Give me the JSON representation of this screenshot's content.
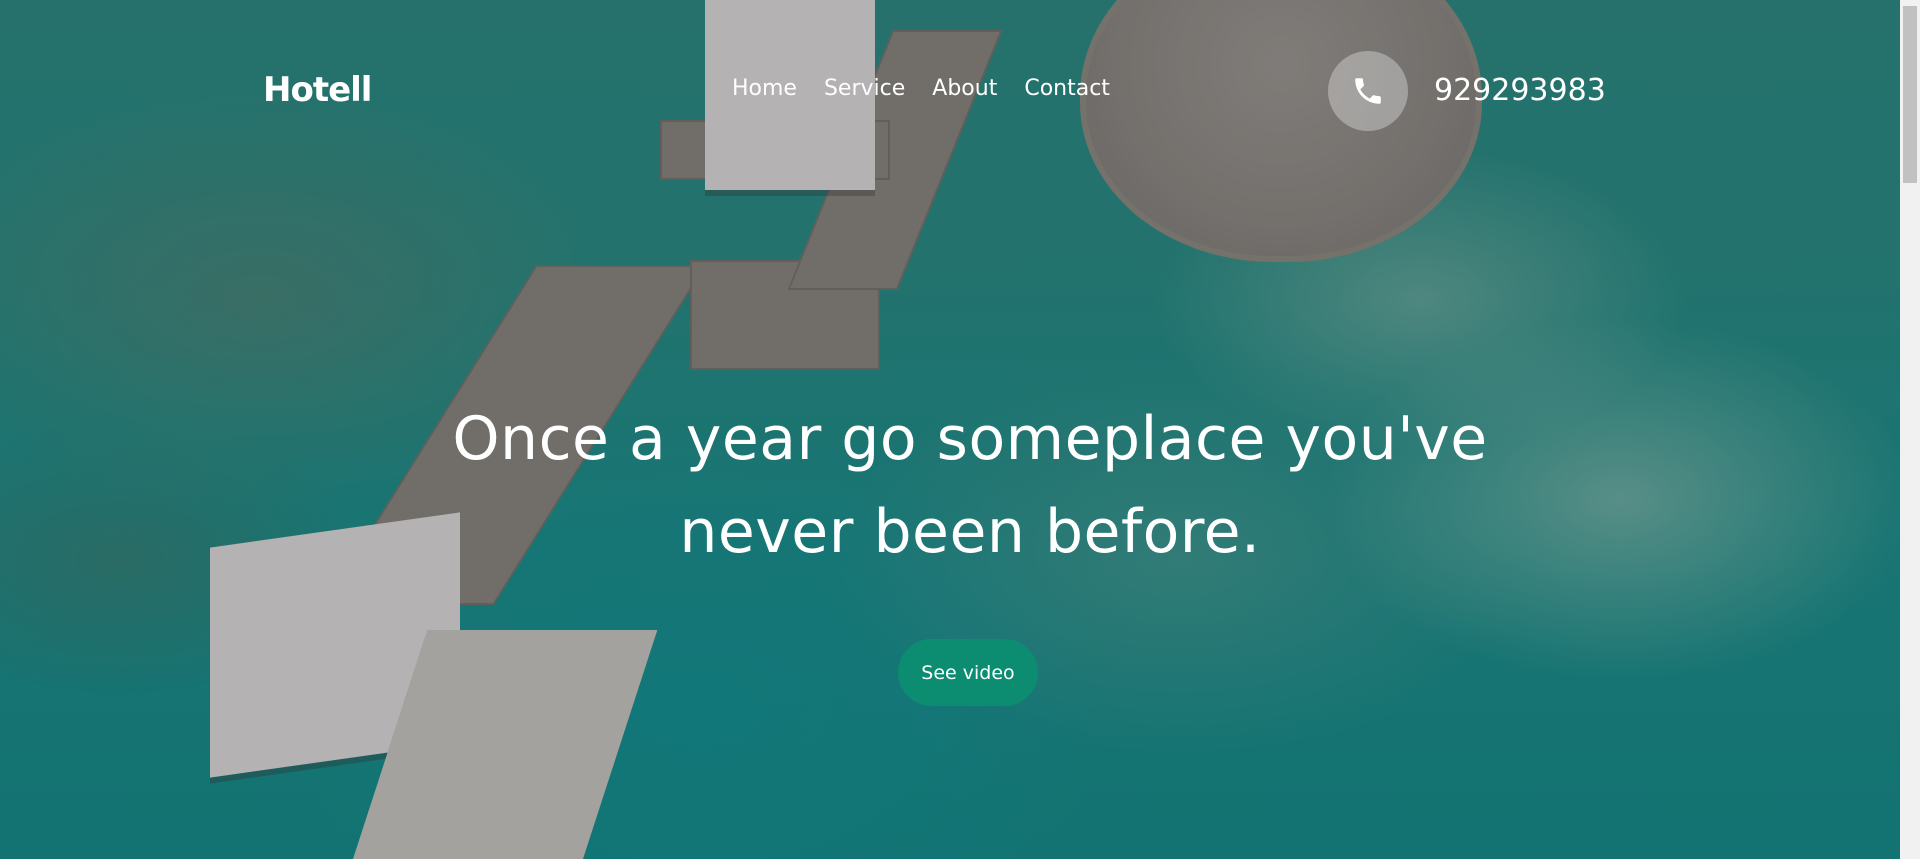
{
  "brand": {
    "logo_text": "Hotell"
  },
  "nav": {
    "items": [
      {
        "label": "Home"
      },
      {
        "label": "Service"
      },
      {
        "label": "About"
      },
      {
        "label": "Contact"
      }
    ]
  },
  "contact": {
    "phone_icon": "phone-icon",
    "phone_number": "929293983"
  },
  "hero": {
    "headline_line1": "Once a year go someplace you've",
    "headline_line2": "never been before.",
    "cta_label": "See video"
  },
  "colors": {
    "accent": "#0c8d71",
    "text": "#ffffff"
  }
}
